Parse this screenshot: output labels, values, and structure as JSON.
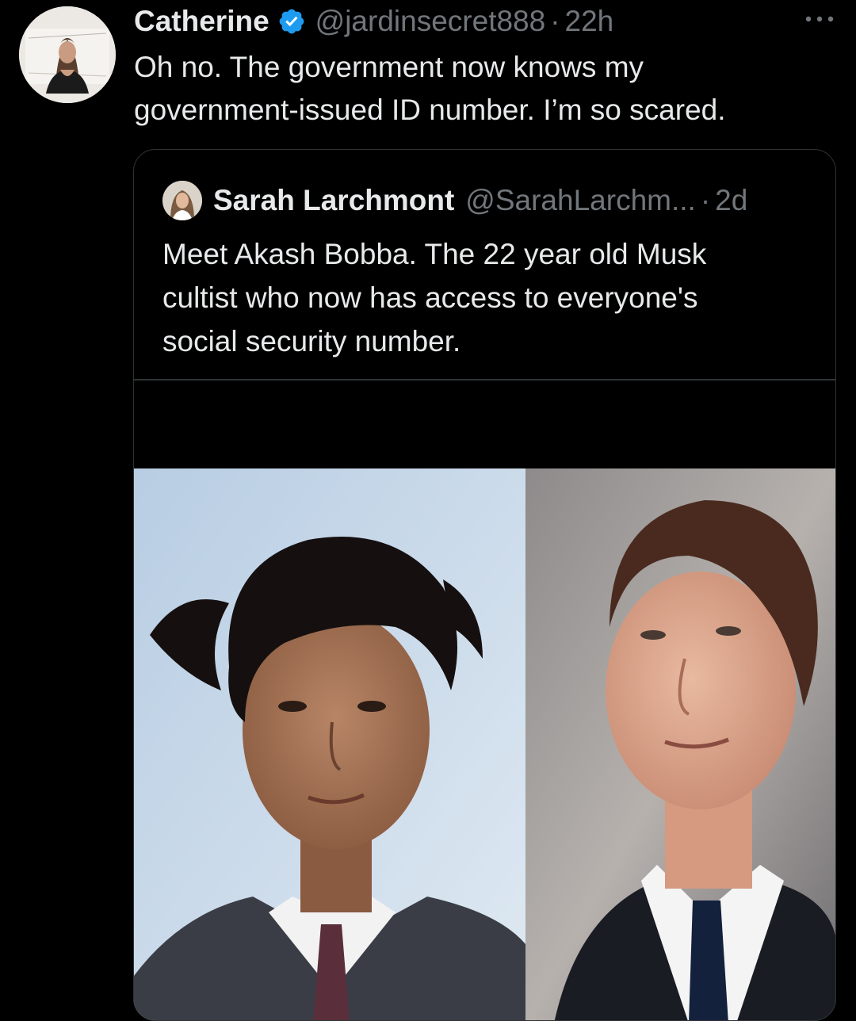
{
  "tweet": {
    "author_name": "Catherine",
    "handle": "@jardinsecret888",
    "separator": "·",
    "time": "22h",
    "text_lines": [
      "Oh no. The government now knows my",
      "government-issued ID number. I’m so scared."
    ],
    "icons": {
      "avatar": "profile-photo",
      "verified": "verified-badge-icon",
      "more": "more-options-icon"
    },
    "colors": {
      "verified": "#1d9bf0",
      "secondary_text": "#71767b",
      "primary_text": "#e7e9ea",
      "border": "#2f3336"
    }
  },
  "quoted_tweet": {
    "author_name": "Sarah Larchmont",
    "handle": "@SarahLarchm...",
    "separator": "·",
    "time": "2d",
    "text_lines": [
      "Meet Akash Bobba. The 22 year old Musk",
      "cultist who now has access to everyone's",
      "social security number."
    ],
    "media": "two-portrait-photos"
  }
}
